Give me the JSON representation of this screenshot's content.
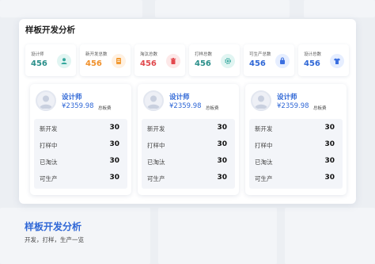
{
  "panel": {
    "title": "样板开发分析"
  },
  "stats": [
    {
      "label": "设计师",
      "value": "456",
      "value_color": "#2a8f8a",
      "icon": "users-icon",
      "icon_bg": "#e1f5f2",
      "icon_color": "#34a79d"
    },
    {
      "label": "新开发总数",
      "value": "456",
      "value_color": "#f0902a",
      "icon": "document-icon",
      "icon_bg": "#fff1e2",
      "icon_color": "#f29a33"
    },
    {
      "label": "淘汰总数",
      "value": "456",
      "value_color": "#e0484c",
      "icon": "trash-icon",
      "icon_bg": "#fde8e8",
      "icon_color": "#e3494f"
    },
    {
      "label": "打样总数",
      "value": "456",
      "value_color": "#2a8f8a",
      "icon": "gear-icon",
      "icon_bg": "#e1f5f2",
      "icon_color": "#34a79d"
    },
    {
      "label": "可生产总数",
      "value": "456",
      "value_color": "#2f67d6",
      "icon": "bag-icon",
      "icon_bg": "#e6eeff",
      "icon_color": "#3b6fe0"
    },
    {
      "label": "设计总数",
      "value": "456",
      "value_color": "#2f67d6",
      "icon": "shirt-icon",
      "icon_bg": "#e6eeff",
      "icon_color": "#3b6fe0"
    }
  ],
  "designers": [
    {
      "name": "设计师",
      "amount": "¥2359.98",
      "amount_label": "总板费",
      "rows": [
        {
          "label": "新开发",
          "value": "30"
        },
        {
          "label": "打样中",
          "value": "30"
        },
        {
          "label": "已淘汰",
          "value": "30"
        },
        {
          "label": "可生产",
          "value": "30"
        }
      ]
    },
    {
      "name": "设计师",
      "amount": "¥2359.98",
      "amount_label": "总板费",
      "rows": [
        {
          "label": "新开发",
          "value": "30"
        },
        {
          "label": "打样中",
          "value": "30"
        },
        {
          "label": "已淘汰",
          "value": "30"
        },
        {
          "label": "可生产",
          "value": "30"
        }
      ]
    },
    {
      "name": "设计师",
      "amount": "¥2359.98",
      "amount_label": "总板费",
      "rows": [
        {
          "label": "新开发",
          "value": "30"
        },
        {
          "label": "打样中",
          "value": "30"
        },
        {
          "label": "已淘汰",
          "value": "30"
        },
        {
          "label": "可生产",
          "value": "30"
        }
      ]
    }
  ],
  "footer": {
    "title": "样板开发分析",
    "subtitle": "开发，打样，生产一览"
  },
  "colors": {
    "accent": "#2f67d6",
    "background": "#eceff3"
  }
}
